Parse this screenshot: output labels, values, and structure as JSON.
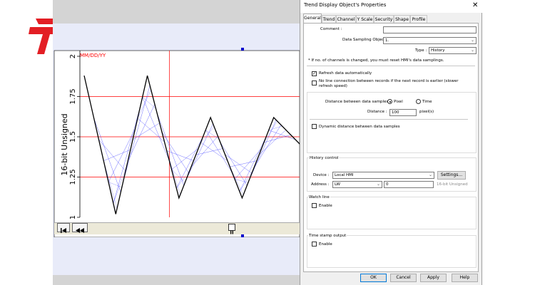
{
  "colors": {
    "logo_red": "#e31e24",
    "grid_red": "#ff0000",
    "trace_blue": "#3333ff",
    "accent": "#0078d7"
  },
  "chart_data": {
    "type": "line",
    "title": "",
    "xlabel": "",
    "ylabel": "16-bit Unsigned",
    "date_label": "MM/DD/YY",
    "ylim": [
      1,
      2
    ],
    "yticks": [
      1,
      1.25,
      1.5,
      1.75,
      2
    ],
    "ytick_labels": [
      "1",
      "1.25",
      "1.5",
      "1.75",
      "2"
    ],
    "grid": true,
    "series": [
      {
        "x": [
          0,
          1,
          2,
          3,
          4,
          5,
          6,
          7
        ],
        "values": [
          1.88,
          1.02,
          1.88,
          1.12,
          1.62,
          1.12,
          1.62,
          1.42
        ]
      }
    ]
  },
  "toolbar": {
    "first_icon": "first-page-icon",
    "rewind_icon": "rewind-icon",
    "pause_icon": "pause-icon"
  },
  "dialog": {
    "title": "Trend Display Object's Properties",
    "close": "✕",
    "tabs": [
      "General",
      "Trend",
      "Channel",
      "Y Scale",
      "Security",
      "Shape",
      "Profile"
    ],
    "comment_label": "Comment :",
    "comment_value": "",
    "sampling_label": "Data Sampling Object index :",
    "sampling_value": "1.",
    "type_label": "Type :",
    "type_value": "History",
    "note": "* If no. of channels is changed, you must reset HMI's data samplings.",
    "refresh_label": "Refresh data automatically",
    "noline_label": "No line connection between records if the next record is earlier (slower refresh speed)",
    "distance_samples_label": "Distance between data samples :",
    "pixel_label": "Pixel",
    "time_label": "Time",
    "distance_label": "Distance :",
    "distance_value": "100",
    "distance_unit": "pixel(s)",
    "dynamic_label": "Dynamic distance between data samples",
    "history_title": "History control",
    "device_label": "Device :",
    "device_value": "Local HMI",
    "settings_label": "Settings...",
    "address_label": "Address :",
    "address_type": "LW",
    "address_value": "0",
    "address_format": "16-bit Unsigned",
    "watch_title": "Watch line",
    "enable_label": "Enable",
    "timestamp_title": "Time stamp output",
    "ok": "OK",
    "cancel": "Cancel",
    "apply": "Apply",
    "help": "Help"
  }
}
